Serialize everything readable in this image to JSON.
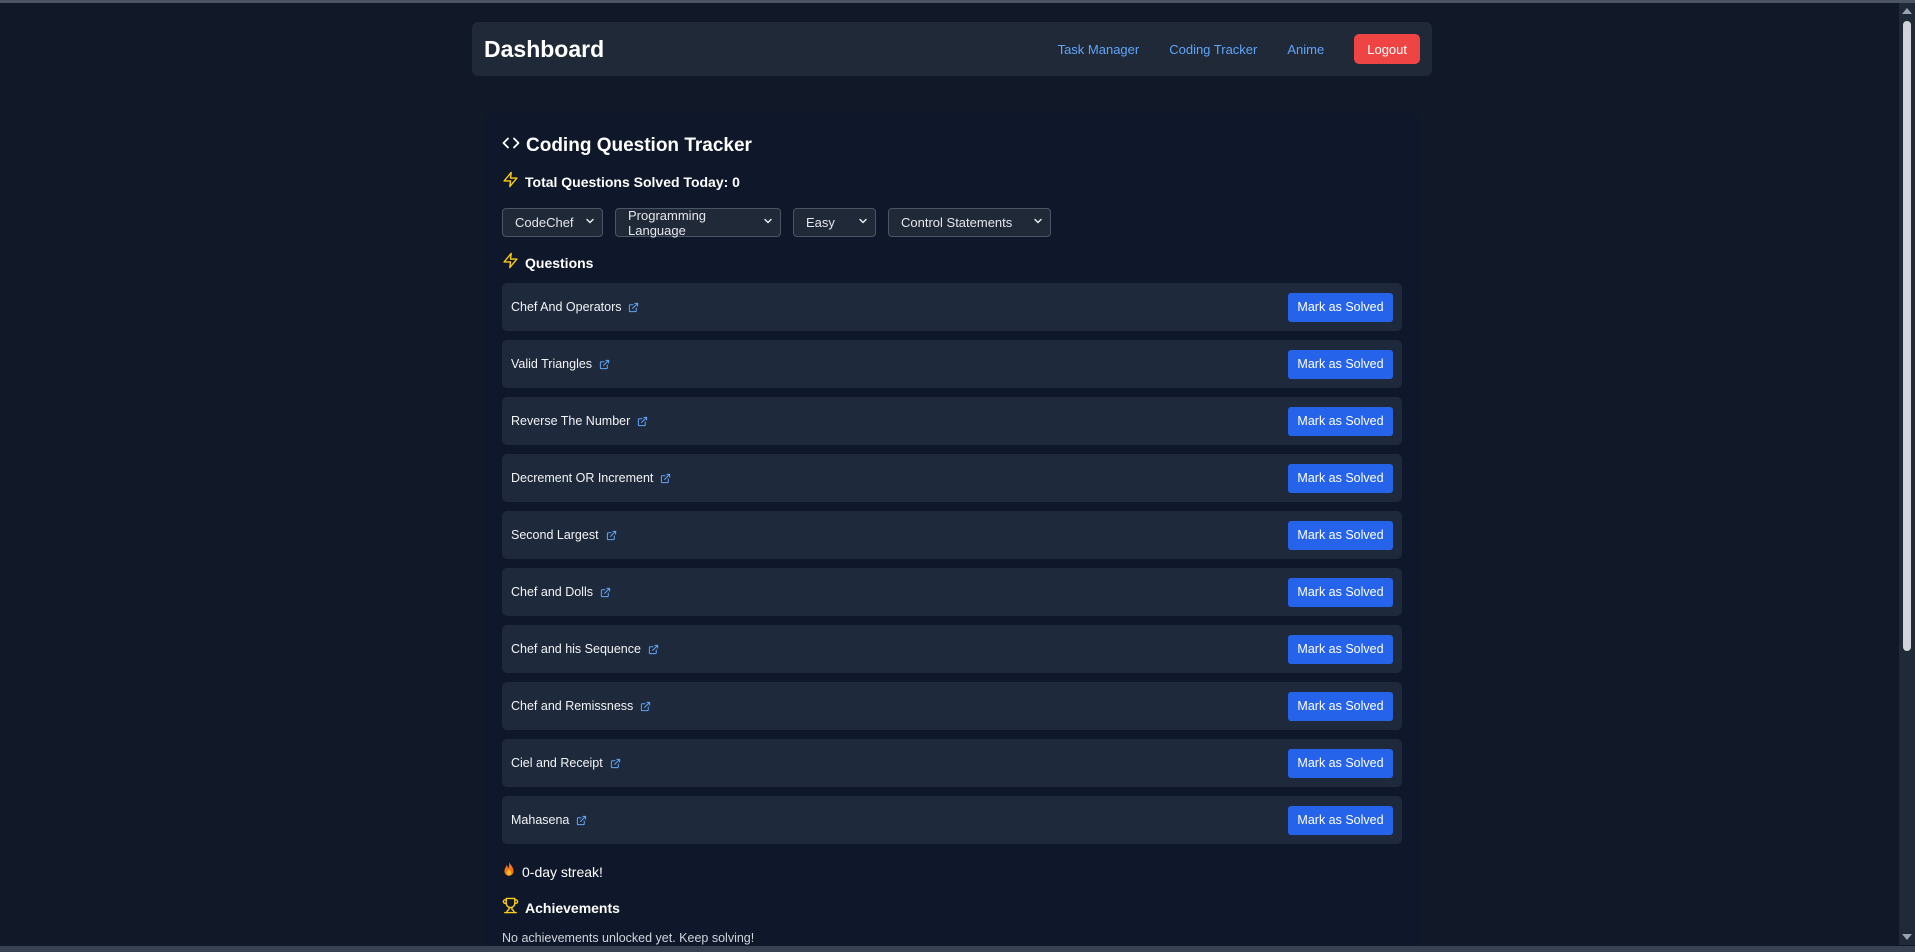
{
  "navbar": {
    "brand": "Dashboard",
    "links": [
      "Task Manager",
      "Coding Tracker",
      "Anime"
    ],
    "logout_label": "Logout"
  },
  "tracker": {
    "title": "Coding Question Tracker",
    "total_label": "Total Questions Solved Today: 0",
    "filters": {
      "platform": "CodeChef",
      "category": "Programming Language",
      "difficulty": "Easy",
      "topic": "Control Statements"
    },
    "questions_heading": "Questions",
    "questions": [
      "Chef And Operators",
      "Valid Triangles",
      "Reverse The Number",
      "Decrement OR Increment",
      "Second Largest",
      "Chef and Dolls",
      "Chef and his Sequence",
      "Chef and Remissness",
      "Ciel and Receipt",
      "Mahasena"
    ],
    "solve_label": "Mark as Solved",
    "streak": "0-day streak!",
    "achievements_heading": "Achievements",
    "achievements_empty": "No achievements unlocked yet. Keep solving!"
  },
  "colors": {
    "background": "#111827",
    "panel": "#1f2937",
    "accent": "#2563eb",
    "link": "#60a5fa",
    "danger": "#ef4444",
    "highlight": "#facc15"
  },
  "icons": {
    "title": "code-icon",
    "total": "lightning-icon",
    "questions": "lightning-icon",
    "link": "external-link-icon",
    "streak": "fire-icon",
    "achievements": "trophy-icon",
    "select": "chevron-down-icon"
  }
}
